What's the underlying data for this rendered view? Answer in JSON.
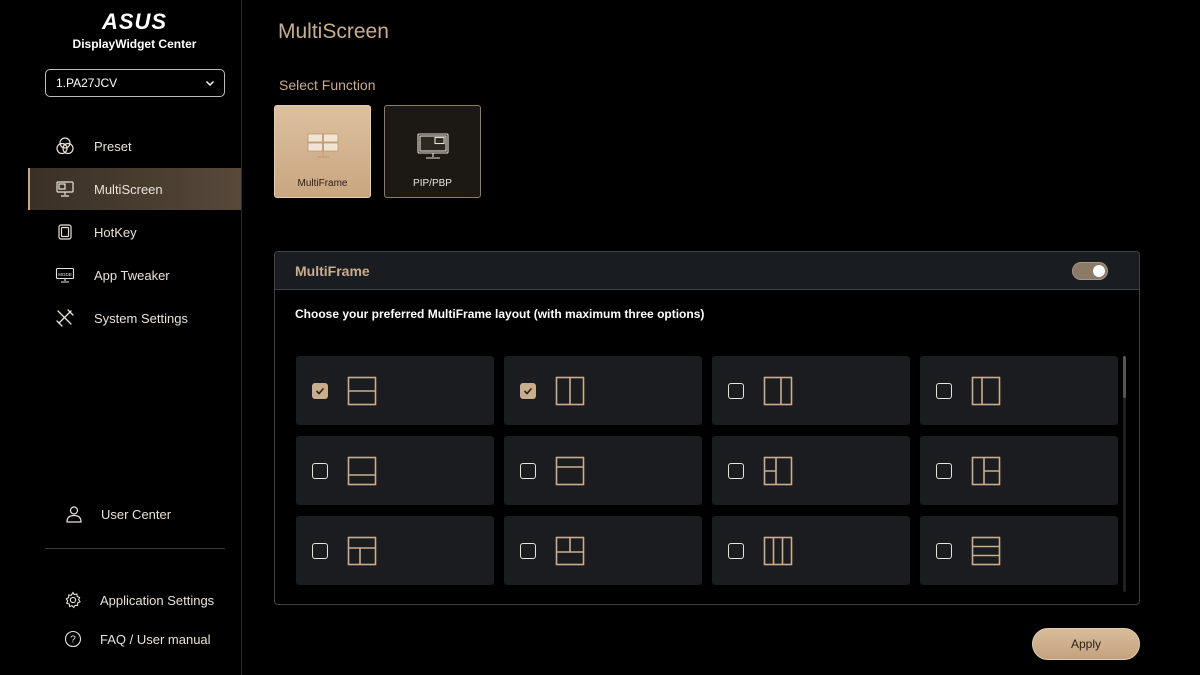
{
  "brand": {
    "logo_text": "ASUS",
    "app_title": "DisplayWidget Center"
  },
  "monitor_select": {
    "value": "1.PA27JCV"
  },
  "sidebar": {
    "items": [
      {
        "label": "Preset",
        "icon": "preset-icon",
        "active": false
      },
      {
        "label": "MultiScreen",
        "icon": "monitor-icon",
        "active": true
      },
      {
        "label": "HotKey",
        "icon": "hotkey-icon",
        "active": false
      },
      {
        "label": "App Tweaker",
        "icon": "mode-icon",
        "active": false
      },
      {
        "label": "System Settings",
        "icon": "tools-icon",
        "active": false
      }
    ],
    "user_center": "User Center",
    "app_settings": "Application Settings",
    "faq": "FAQ / User manual"
  },
  "main": {
    "title": "MultiScreen",
    "select_function_label": "Select Function",
    "functions": [
      {
        "label": "MultiFrame",
        "selected": true
      },
      {
        "label": "PIP/PBP",
        "selected": false
      }
    ],
    "panel": {
      "title": "MultiFrame",
      "toggle_on": true,
      "description": "Choose your preferred MultiFrame layout (with maximum three options)"
    },
    "layouts": [
      {
        "id": "split-horizontal",
        "checked": true
      },
      {
        "id": "split-vertical",
        "checked": true
      },
      {
        "id": "split-vertical-wide-right",
        "checked": false
      },
      {
        "id": "split-vertical-wide-left",
        "checked": false
      },
      {
        "id": "split-horizontal-top-large",
        "checked": false
      },
      {
        "id": "split-horizontal-bottom-large",
        "checked": false
      },
      {
        "id": "three-left-split",
        "checked": false
      },
      {
        "id": "three-right-split",
        "checked": false
      },
      {
        "id": "three-bottom-split",
        "checked": false
      },
      {
        "id": "three-top-split",
        "checked": false
      },
      {
        "id": "three-columns",
        "checked": false
      },
      {
        "id": "three-rows",
        "checked": false
      }
    ],
    "apply_label": "Apply"
  },
  "colors": {
    "accent": "#c9ad8c",
    "panel_bg": "#1a1c20",
    "active_nav": "#4a3e30"
  }
}
